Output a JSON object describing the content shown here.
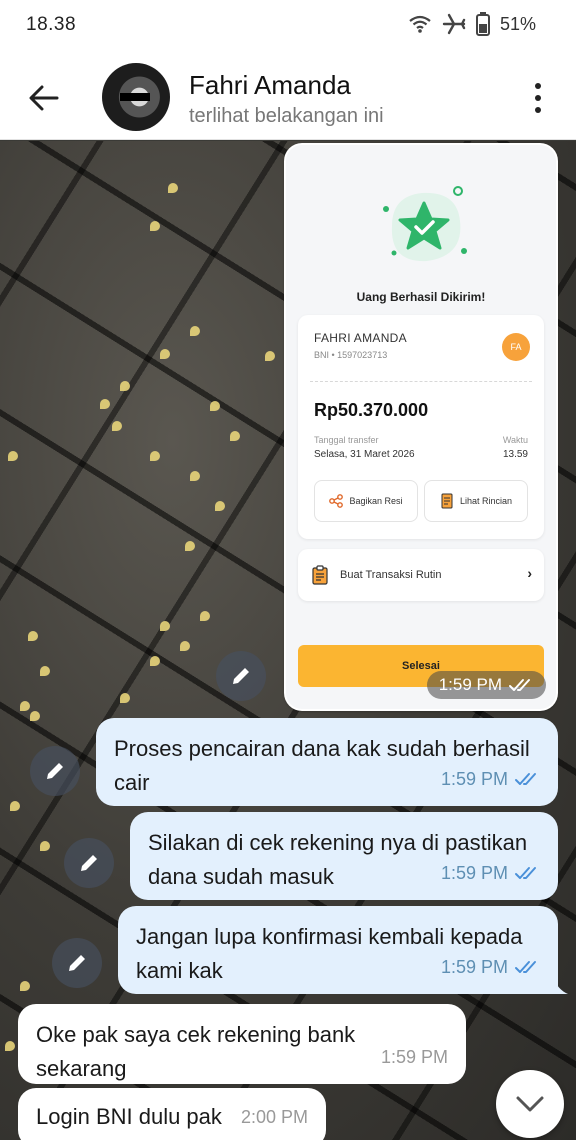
{
  "status_bar": {
    "time": "18.38",
    "battery": "51%",
    "icons": [
      "wifi-icon",
      "airplane-mode-icon",
      "battery-icon"
    ]
  },
  "header": {
    "name": "Fahri Amanda",
    "status": "terlihat belakangan ini"
  },
  "receipt": {
    "title": "Uang Berhasil Dikirim!",
    "recipient_name": "FAHRI AMANDA",
    "recipient_account": "BNI • 1597023713",
    "initials": "FA",
    "amount": "Rp50.370.000",
    "date_label": "Tanggal transfer",
    "date_value": "Selasa, 31 Maret 2026",
    "time_label": "Waktu",
    "time_value": "13.59",
    "share_label": "Bagikan Resi",
    "detail_label": "Lihat Rincian",
    "routine_label": "Buat Transaksi Rutin",
    "done_label": "Selesai",
    "accent_color": "#fbb531",
    "success_color": "#2fb56a"
  },
  "image_message": {
    "time": "1:59 PM"
  },
  "messages": [
    {
      "direction": "out",
      "text": "Proses pencairan dana kak sudah berhasil cair",
      "time": "1:59 PM"
    },
    {
      "direction": "out",
      "text": "Silakan di cek rekening nya di pastikan dana sudah masuk",
      "time": "1:59 PM"
    },
    {
      "direction": "out",
      "text": "Jangan lupa konfirmasi kembali kepada kami kak",
      "time": "1:59 PM"
    },
    {
      "direction": "in",
      "text": "Oke pak saya cek rekening bank sekarang",
      "time": "1:59 PM"
    },
    {
      "direction": "in",
      "text": "Login BNI dulu pak",
      "time": "2:00 PM"
    }
  ]
}
